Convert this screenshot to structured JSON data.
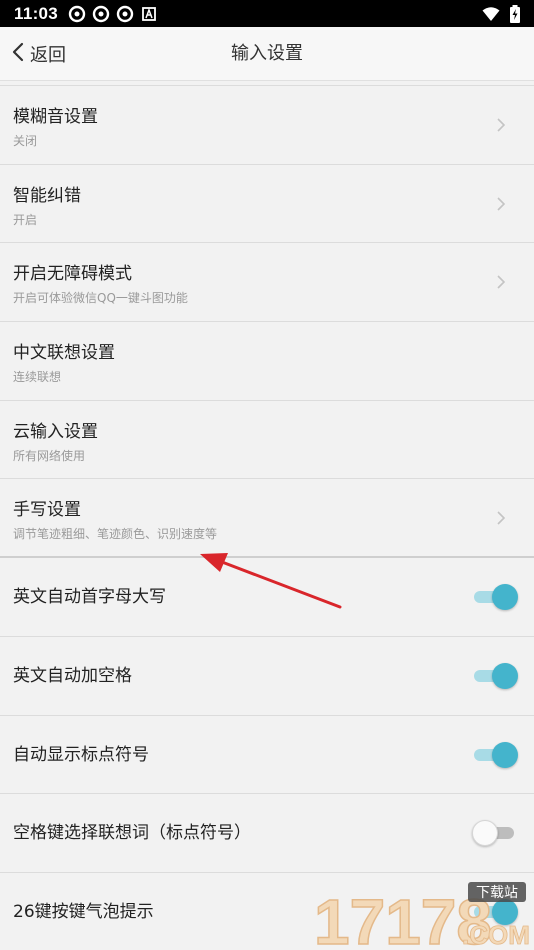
{
  "status_bar": {
    "time": "11:03"
  },
  "header": {
    "back_label": "返回",
    "title": "输入设置"
  },
  "settings": [
    {
      "title": "模糊音设置",
      "subtitle": "关闭",
      "chevron": true
    },
    {
      "title": "智能纠错",
      "subtitle": "开启",
      "chevron": true
    },
    {
      "title": "开启无障碍模式",
      "subtitle": "开启可体验微信QQ一键斗图功能",
      "chevron": true
    },
    {
      "title": "中文联想设置",
      "subtitle": "连续联想",
      "chevron": false
    },
    {
      "title": "云输入设置",
      "subtitle": "所有网络使用",
      "chevron": false
    },
    {
      "title": "手写设置",
      "subtitle": "调节笔迹粗细、笔迹颜色、识别速度等",
      "chevron": true
    }
  ],
  "toggles": [
    {
      "title": "英文自动首字母大写",
      "on": true
    },
    {
      "title": "英文自动加空格",
      "on": true
    },
    {
      "title": "自动显示标点符号",
      "on": true
    },
    {
      "title": "空格键选择联想词（标点符号）",
      "on": false
    },
    {
      "title": "26键按键气泡提示",
      "on": true
    }
  ],
  "colors": {
    "accent": "#44b4cc",
    "annotation_arrow": "#d9262b"
  },
  "watermark": {
    "number": "17178",
    "label": "下载站",
    "domain": ".COM"
  }
}
